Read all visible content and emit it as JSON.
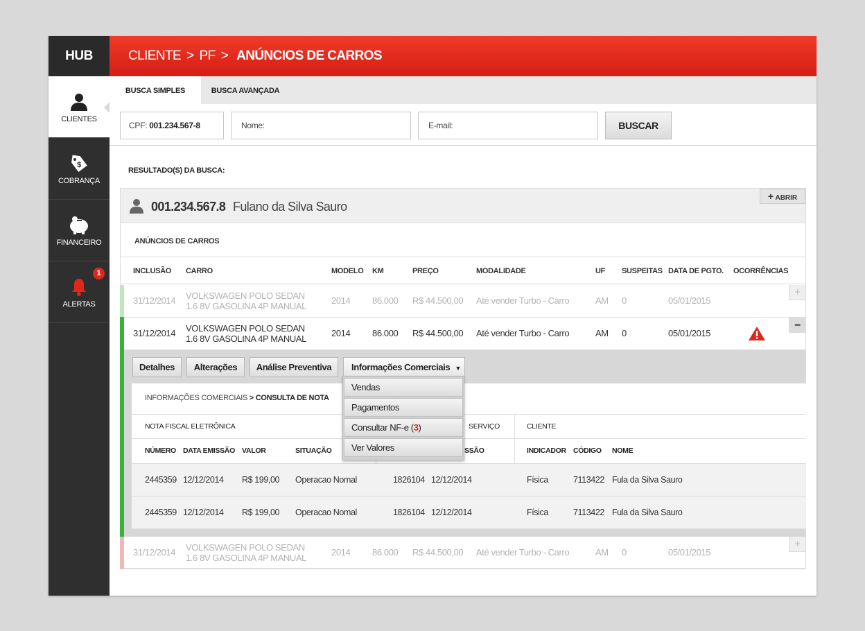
{
  "sidebar": {
    "hub": "HUB",
    "items": [
      {
        "label": "CLIENTES",
        "icon": "user-icon"
      },
      {
        "label": "COBRANÇA",
        "icon": "price-tag-icon"
      },
      {
        "label": "FINANCEIRO",
        "icon": "piggy-bank-icon"
      },
      {
        "label": "ALERTAS",
        "icon": "bell-icon",
        "badge": "1"
      }
    ]
  },
  "header": {
    "crumb1": "CLIENTE",
    "crumb2": "PF",
    "current": "ANÚNCIOS DE CARROS",
    "sep": ">"
  },
  "tabs": {
    "simple": "BUSCA SIMPLES",
    "advanced": "BUSCA AVANÇADA"
  },
  "search": {
    "cpf_label": "CPF:",
    "cpf_value": "001.234.567-8",
    "nome_label": "Nome:",
    "email_label": "E-mail:",
    "button": "BUSCAR"
  },
  "results": {
    "label": "RESULTADO(S) DA BUSCA:",
    "client_cpf": "001.234.567.8",
    "client_name": "Fulano da Silva Sauro",
    "open_button": "ABRIR",
    "section_title": "ANÚNCIOS DE CARROS"
  },
  "table": {
    "columns": [
      "INCLUSÃO",
      "CARRO",
      "MODELO",
      "KM",
      "PREÇO",
      "MODALIDADE",
      "UF",
      "SUSPEITAS",
      "DATA DE PGTO.",
      "OCORRÊNCIAS"
    ],
    "rows": [
      {
        "inclusao": "31/12/2014",
        "carro1": "VOLKSWAGEN POLO SEDAN",
        "carro2": "1.6 8V GASOLINA 4P MANUAL",
        "modelo": "2014",
        "km": "86.000",
        "preco": "R$ 44.500,00",
        "modalidade": "Até vender Turbo - Carro",
        "uf": "AM",
        "suspeitas": "0",
        "data_pgto": "05/01/2015",
        "status_color": "#bfe6bf"
      },
      {
        "inclusao": "31/12/2014",
        "carro1": "VOLKSWAGEN POLO SEDAN",
        "carro2": "1.6 8V GASOLINA 4P MANUAL",
        "modelo": "2014",
        "km": "86.000",
        "preco": "R$ 44.500,00",
        "modalidade": "Até vender Turbo - Carro",
        "uf": "AM",
        "suspeitas": "0",
        "data_pgto": "05/01/2015",
        "status_color": "#36b234"
      },
      {
        "inclusao": "31/12/2014",
        "carro1": "VOLKSWAGEN POLO SEDAN",
        "carro2": "1.6 8V GASOLINA 4P MANUAL",
        "modelo": "2014",
        "km": "86.000",
        "preco": "R$ 44.500,00",
        "modalidade": "Até vender Turbo - Carro",
        "uf": "AM",
        "suspeitas": "0",
        "data_pgto": "05/01/2015",
        "status_color": "#f0b9b9"
      }
    ]
  },
  "detail": {
    "buttons": [
      "Detalhes",
      "Alterações",
      "Análise Preventiva",
      "Informações Comerciais"
    ],
    "breadcrumb_a": "INFORMAÇÕES COMERCIAIS",
    "breadcrumb_sep": ">",
    "breadcrumb_b": "CONSULTA DE NOTA",
    "group_nf": "NOTA FISCAL ELETRÔNICA",
    "group_service": "SERVIÇO",
    "group_client": "CLIENTE",
    "columns": [
      "NÚMERO",
      "DATA EMISSÃO",
      "VALOR",
      "SITUAÇÃO",
      "SSÃO",
      "INDICADOR",
      "CÓDIGO",
      "NOME"
    ],
    "rows": [
      {
        "numero": "2445359",
        "data": "12/12/2014",
        "valor": "R$ 199,00",
        "situacao": "Operacao Nomal",
        "rps": "1826104",
        "emissao": "12/12/2014",
        "indicador": "Física",
        "codigo": "7113422",
        "nome": "Fula da Silva Sauro"
      },
      {
        "numero": "2445359",
        "data": "12/12/2014",
        "valor": "R$ 199,00",
        "situacao": "Operacao Nomal",
        "rps": "1826104",
        "emissao": "12/12/2014",
        "indicador": "Física",
        "codigo": "7113422",
        "nome": "Fula da Silva Sauro"
      }
    ]
  },
  "dropdown": {
    "items": [
      "Vendas",
      "Pagamentos",
      "Consultar NF-e (",
      "Ver Valores"
    ],
    "nfe_count": "3",
    "nfe_close": ")"
  },
  "colors": {
    "accent": "#e02a1c",
    "sidebar": "#2f2f2f",
    "active_row": "#36b234",
    "alert": "#e0261d"
  }
}
